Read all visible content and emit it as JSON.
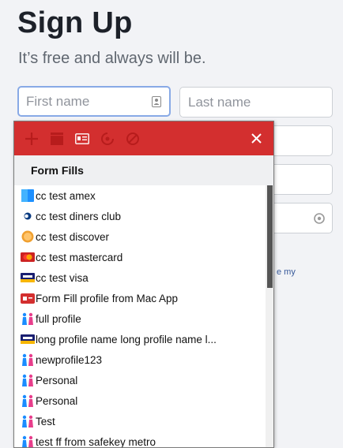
{
  "page": {
    "title": "Sign Up",
    "subtitle": "It’s free and always will be.",
    "policy_fragment": "e my"
  },
  "form": {
    "first_name_placeholder": "First name",
    "last_name_placeholder": "Last name",
    "first_name_value": "",
    "last_name_value": ""
  },
  "popup": {
    "toolbar": {
      "icons": [
        "plus-icon",
        "note-icon",
        "identity-card-icon",
        "generate-password-icon",
        "never-icon",
        "close-icon"
      ],
      "color": "#d32f2f"
    },
    "header": "Form Fills",
    "items": [
      {
        "label": "cc test amex",
        "icon": "amex-card-icon"
      },
      {
        "label": "cc test diners club",
        "icon": "diners-card-icon"
      },
      {
        "label": "cc test discover",
        "icon": "discover-card-icon"
      },
      {
        "label": "cc test mastercard",
        "icon": "mastercard-icon"
      },
      {
        "label": "cc test visa",
        "icon": "visa-card-icon"
      },
      {
        "label": "Form Fill profile from Mac App",
        "icon": "id-card-icon"
      },
      {
        "label": "full profile",
        "icon": "person-icon"
      },
      {
        "label": "long profile name long profile name l...",
        "icon": "visa-card-icon"
      },
      {
        "label": "newprofile123",
        "icon": "person-icon"
      },
      {
        "label": "Personal",
        "icon": "person-icon"
      },
      {
        "label": "Personal",
        "icon": "person-icon"
      },
      {
        "label": "Test",
        "icon": "person-icon"
      },
      {
        "label": "test ff from safekey metro",
        "icon": "person-icon"
      }
    ]
  }
}
